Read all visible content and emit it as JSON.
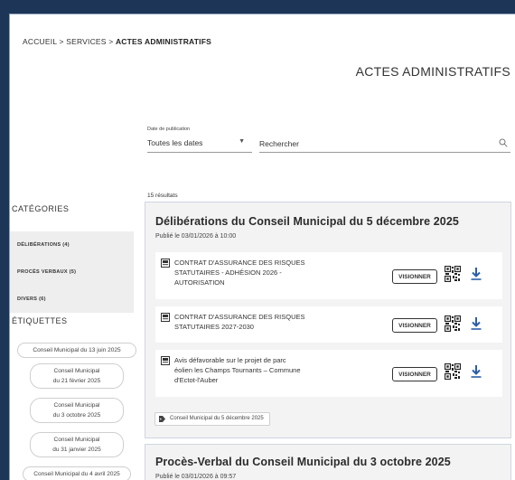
{
  "breadcrumb": {
    "home": "ACCUEIL",
    "sep": ">",
    "services": "SERVICES",
    "current": "ACTES ADMINISTRATIFS"
  },
  "page_title": "ACTES ADMINISTRATIFS",
  "filters": {
    "date_label": "Date de publication",
    "date_value": "Toutes les dates",
    "search_placeholder": "Rechercher"
  },
  "results_count": "15 résultats",
  "sidebar": {
    "categories_title": "CATÉGORIES",
    "categories": [
      {
        "label": "DÉLIBÉRATIONS (4)"
      },
      {
        "label": "PROCÈS VERBAUX (5)"
      },
      {
        "label": "DIVERS (6)"
      }
    ],
    "tags_title": "ÉTIQUETTES",
    "tags": [
      {
        "line1": "Conseil Municipal du 13 juin 2025",
        "line2": ""
      },
      {
        "line1": "Conseil Municipal",
        "line2": "du 21 février 2025"
      },
      {
        "line1": "Conseil Municipal",
        "line2": "du 3 octobre 2025"
      },
      {
        "line1": "Conseil Municipal",
        "line2": "du 31 janvier 2025"
      },
      {
        "line1": "Conseil Municipal du 4 avril 2025",
        "line2": ""
      }
    ]
  },
  "cards": [
    {
      "title": "Délibérations du Conseil Municipal du 5 décembre 2025",
      "date": "Publié le 03/01/2026 à 10:00",
      "documents": [
        {
          "lines": [
            "CONTRAT D'ASSURANCE DES RISQUES",
            "STATUTAIRES - ADHÉSION 2026 -",
            "AUTORISATION"
          ],
          "button": "VISIONNER"
        },
        {
          "lines": [
            "CONTRAT D'ASSURANCE DES RISQUES",
            "STATUTAIRES 2027-2030"
          ],
          "button": "VISIONNER"
        },
        {
          "lines": [
            "Avis défavorable sur le projet de parc",
            "éolien les Champs Tournants – Commune",
            "d'Ectot-l'Auber"
          ],
          "button": "VISIONNER"
        }
      ],
      "tag": "Conseil Municipal du 5 décembre 2025"
    },
    {
      "title": "Procès-Verbal du Conseil Municipal du 3 octobre 2025",
      "date": "Publié le 03/01/2026 à 09:57"
    }
  ],
  "colors": {
    "frame": "#1d3557",
    "accent_blue": "#2a5fa8",
    "card_bg": "#f3f3f3"
  }
}
